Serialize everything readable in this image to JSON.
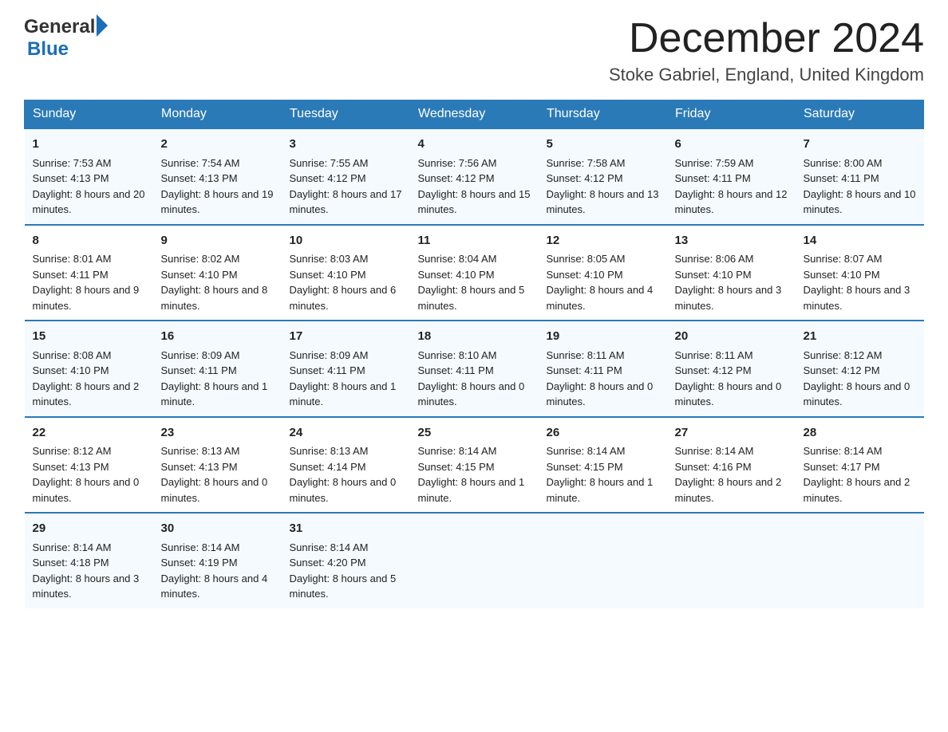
{
  "header": {
    "logo_general": "General",
    "logo_blue": "Blue",
    "month_title": "December 2024",
    "location": "Stoke Gabriel, England, United Kingdom"
  },
  "weekdays": [
    "Sunday",
    "Monday",
    "Tuesday",
    "Wednesday",
    "Thursday",
    "Friday",
    "Saturday"
  ],
  "weeks": [
    [
      {
        "day": "1",
        "sunrise": "7:53 AM",
        "sunset": "4:13 PM",
        "daylight": "8 hours and 20 minutes."
      },
      {
        "day": "2",
        "sunrise": "7:54 AM",
        "sunset": "4:13 PM",
        "daylight": "8 hours and 19 minutes."
      },
      {
        "day": "3",
        "sunrise": "7:55 AM",
        "sunset": "4:12 PM",
        "daylight": "8 hours and 17 minutes."
      },
      {
        "day": "4",
        "sunrise": "7:56 AM",
        "sunset": "4:12 PM",
        "daylight": "8 hours and 15 minutes."
      },
      {
        "day": "5",
        "sunrise": "7:58 AM",
        "sunset": "4:12 PM",
        "daylight": "8 hours and 13 minutes."
      },
      {
        "day": "6",
        "sunrise": "7:59 AM",
        "sunset": "4:11 PM",
        "daylight": "8 hours and 12 minutes."
      },
      {
        "day": "7",
        "sunrise": "8:00 AM",
        "sunset": "4:11 PM",
        "daylight": "8 hours and 10 minutes."
      }
    ],
    [
      {
        "day": "8",
        "sunrise": "8:01 AM",
        "sunset": "4:11 PM",
        "daylight": "8 hours and 9 minutes."
      },
      {
        "day": "9",
        "sunrise": "8:02 AM",
        "sunset": "4:10 PM",
        "daylight": "8 hours and 8 minutes."
      },
      {
        "day": "10",
        "sunrise": "8:03 AM",
        "sunset": "4:10 PM",
        "daylight": "8 hours and 6 minutes."
      },
      {
        "day": "11",
        "sunrise": "8:04 AM",
        "sunset": "4:10 PM",
        "daylight": "8 hours and 5 minutes."
      },
      {
        "day": "12",
        "sunrise": "8:05 AM",
        "sunset": "4:10 PM",
        "daylight": "8 hours and 4 minutes."
      },
      {
        "day": "13",
        "sunrise": "8:06 AM",
        "sunset": "4:10 PM",
        "daylight": "8 hours and 3 minutes."
      },
      {
        "day": "14",
        "sunrise": "8:07 AM",
        "sunset": "4:10 PM",
        "daylight": "8 hours and 3 minutes."
      }
    ],
    [
      {
        "day": "15",
        "sunrise": "8:08 AM",
        "sunset": "4:10 PM",
        "daylight": "8 hours and 2 minutes."
      },
      {
        "day": "16",
        "sunrise": "8:09 AM",
        "sunset": "4:11 PM",
        "daylight": "8 hours and 1 minute."
      },
      {
        "day": "17",
        "sunrise": "8:09 AM",
        "sunset": "4:11 PM",
        "daylight": "8 hours and 1 minute."
      },
      {
        "day": "18",
        "sunrise": "8:10 AM",
        "sunset": "4:11 PM",
        "daylight": "8 hours and 0 minutes."
      },
      {
        "day": "19",
        "sunrise": "8:11 AM",
        "sunset": "4:11 PM",
        "daylight": "8 hours and 0 minutes."
      },
      {
        "day": "20",
        "sunrise": "8:11 AM",
        "sunset": "4:12 PM",
        "daylight": "8 hours and 0 minutes."
      },
      {
        "day": "21",
        "sunrise": "8:12 AM",
        "sunset": "4:12 PM",
        "daylight": "8 hours and 0 minutes."
      }
    ],
    [
      {
        "day": "22",
        "sunrise": "8:12 AM",
        "sunset": "4:13 PM",
        "daylight": "8 hours and 0 minutes."
      },
      {
        "day": "23",
        "sunrise": "8:13 AM",
        "sunset": "4:13 PM",
        "daylight": "8 hours and 0 minutes."
      },
      {
        "day": "24",
        "sunrise": "8:13 AM",
        "sunset": "4:14 PM",
        "daylight": "8 hours and 0 minutes."
      },
      {
        "day": "25",
        "sunrise": "8:14 AM",
        "sunset": "4:15 PM",
        "daylight": "8 hours and 1 minute."
      },
      {
        "day": "26",
        "sunrise": "8:14 AM",
        "sunset": "4:15 PM",
        "daylight": "8 hours and 1 minute."
      },
      {
        "day": "27",
        "sunrise": "8:14 AM",
        "sunset": "4:16 PM",
        "daylight": "8 hours and 2 minutes."
      },
      {
        "day": "28",
        "sunrise": "8:14 AM",
        "sunset": "4:17 PM",
        "daylight": "8 hours and 2 minutes."
      }
    ],
    [
      {
        "day": "29",
        "sunrise": "8:14 AM",
        "sunset": "4:18 PM",
        "daylight": "8 hours and 3 minutes."
      },
      {
        "day": "30",
        "sunrise": "8:14 AM",
        "sunset": "4:19 PM",
        "daylight": "8 hours and 4 minutes."
      },
      {
        "day": "31",
        "sunrise": "8:14 AM",
        "sunset": "4:20 PM",
        "daylight": "8 hours and 5 minutes."
      },
      null,
      null,
      null,
      null
    ]
  ],
  "labels": {
    "sunrise": "Sunrise:",
    "sunset": "Sunset:",
    "daylight": "Daylight:"
  }
}
